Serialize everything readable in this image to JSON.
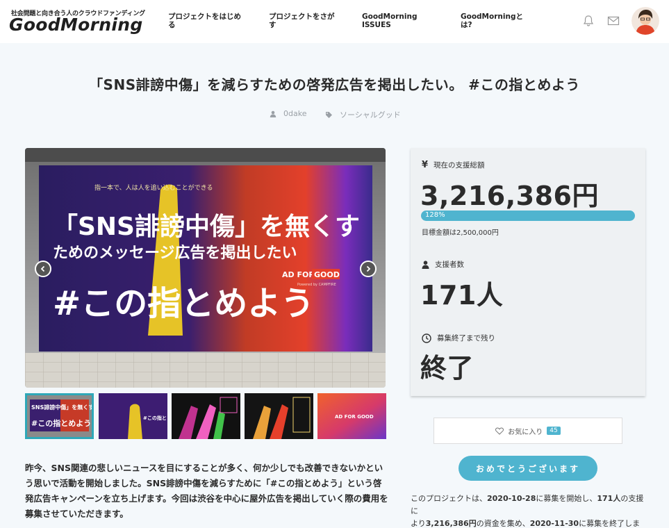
{
  "header": {
    "tagline": "社会問題と向き合う人のクラウドファンディング",
    "logo": "GoodMorning",
    "nav": [
      {
        "line1": "プロジェクトをはじめ",
        "line2": "る"
      },
      {
        "line1": "プロジェクトをさが",
        "line2": "す"
      },
      {
        "line1": "GoodMorning",
        "line2": "ISSUES"
      },
      {
        "line1": "GoodMorningと",
        "line2": "は?"
      }
    ],
    "icons": [
      "bell-icon",
      "mail-icon"
    ]
  },
  "project": {
    "title": "「SNS誹謗中傷」を減らすための啓発広告を掲出したい。 #この指とめよう",
    "author": "0dake",
    "category": "ソーシャルグッド"
  },
  "billboard": {
    "line1": "「SNS誹謗中傷」を無くす",
    "line2": "ためのメッセージ広告を掲出したい",
    "line3": "#この指とめよう",
    "side_text": "この指と",
    "badge_prefix": "AD FOR",
    "badge_word": "GOOD",
    "powered": "Powered by CAMPFIRE"
  },
  "thumbs": {
    "t1_line1": "SNS誹謗中傷」を無くす",
    "t1_line2": "#この指とめよう",
    "t2": "#この指と",
    "t3": "",
    "t5_badge": "AD FOR GOOD"
  },
  "description": "昨今、SNS関連の悲しいニュースを目にすることが多く、何か少しでも改善できないかという思いで活動を開始しました。SNS誹謗中傷を減らすために「#この指とめよう」という啓発広告キャンペーンを立ち上げます。今回は渋谷を中心に屋外広告を掲出していく際の費用を募集させていただきます。",
  "stats": {
    "total_label": "現在の支援総額",
    "total_value": "3,216,386円",
    "progress_text": "128%",
    "progress_fraction": 1.0,
    "goal_text": "目標金額は2,500,000円",
    "supporters_label": "支援者数",
    "supporters_value": "171人",
    "remaining_label": "募集終了まで残り",
    "remaining_value": "終了"
  },
  "favorite": {
    "label": "お気に入り",
    "count": "45"
  },
  "cta_label": "おめでとうございます",
  "summary": {
    "p1": "このプロジェクトは、",
    "start": "2020-10-28",
    "p2": "に募集を開始し、",
    "supporters": "171人",
    "p3": "の支援に",
    "p4": "より",
    "amount": "3,216,386円",
    "p5": "の資金を集め、",
    "end": "2020-11-30",
    "p6": "に募集を終了しました"
  },
  "colors": {
    "accent": "#4fb4cf",
    "thumb_border": "#2ea8b8"
  }
}
